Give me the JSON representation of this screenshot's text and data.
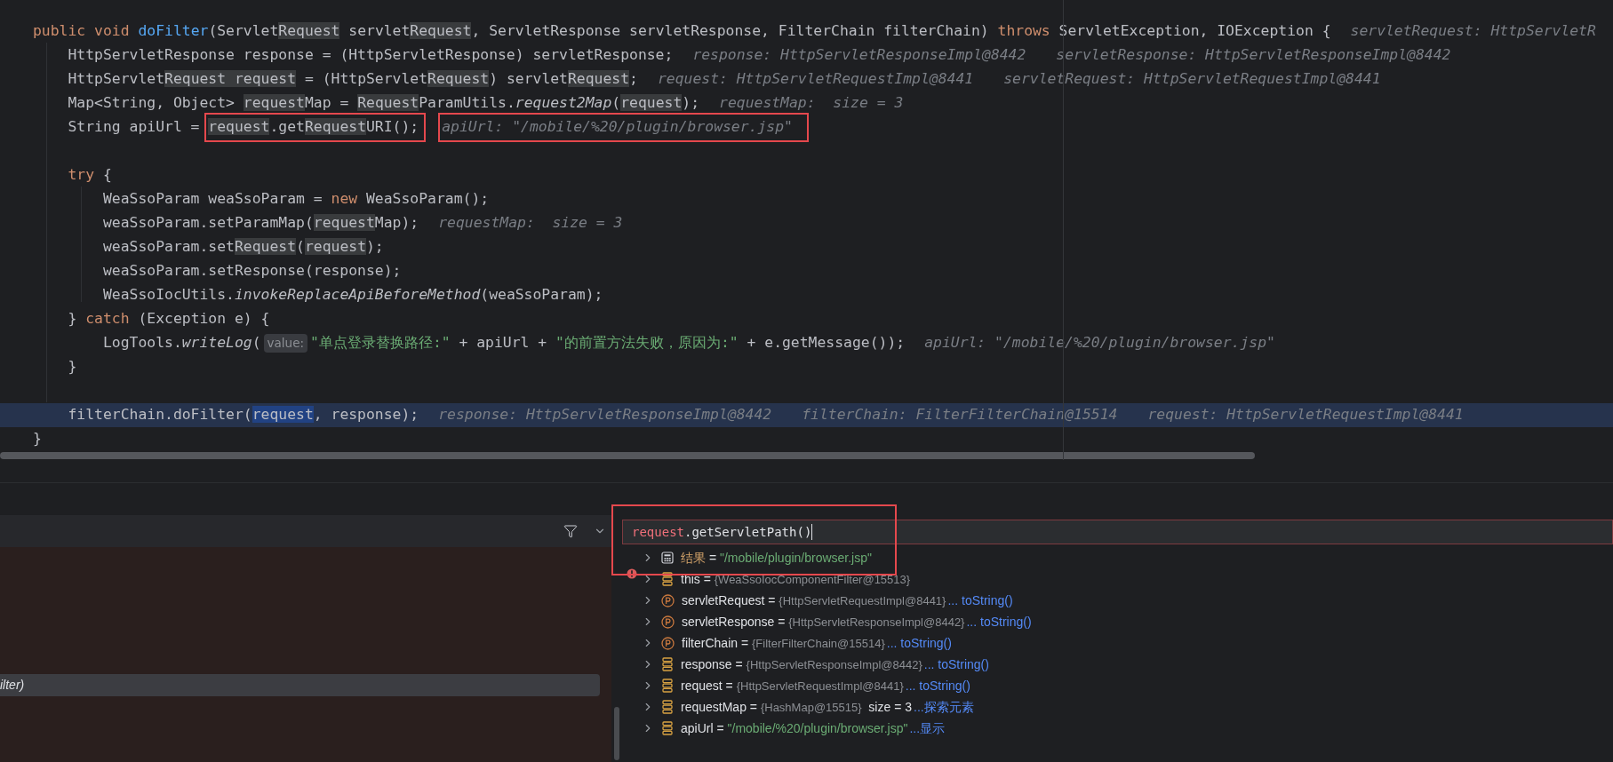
{
  "editor": {
    "lines": [
      {
        "current": false,
        "segments": [
          {
            "kind": "keyword",
            "text": "public void "
          },
          {
            "kind": "declaration",
            "text": "doFilter"
          },
          {
            "kind": "plain",
            "text": "(Servlet"
          },
          {
            "kind": "occurrence",
            "text": "Request"
          },
          {
            "kind": "plain",
            "text": " servlet"
          },
          {
            "kind": "occurrence",
            "text": "Request"
          },
          {
            "kind": "plain",
            "text": ", ServletResponse servletResponse, FilterChain filterChain) "
          },
          {
            "kind": "keyword",
            "text": "throws"
          },
          {
            "kind": "plain",
            "text": " ServletException, IOException {"
          },
          {
            "kind": "hint",
            "text": "servletRequest: HttpServletR"
          }
        ],
        "children": [
          {
            "current": false,
            "segments": [
              {
                "kind": "plain",
                "text": "HttpServletResponse response = (HttpServletResponse) servletResponse;"
              },
              {
                "kind": "hint",
                "text": "response: HttpServletResponseImpl@8442"
              },
              {
                "kind": "hint",
                "text": "servletResponse: HttpServletResponseImpl@8442"
              }
            ]
          },
          {
            "current": false,
            "segments": [
              {
                "kind": "plain",
                "text": "HttpServlet"
              },
              {
                "kind": "occurrence",
                "text": "Request request"
              },
              {
                "kind": "plain",
                "text": " = (HttpServlet"
              },
              {
                "kind": "occurrence",
                "text": "Request"
              },
              {
                "kind": "plain",
                "text": ") servlet"
              },
              {
                "kind": "occurrence",
                "text": "Request"
              },
              {
                "kind": "plain",
                "text": ";"
              },
              {
                "kind": "hint",
                "text": "request: HttpServletRequestImpl@8441"
              },
              {
                "kind": "hint",
                "text": "servletRequest: HttpServletRequestImpl@8441"
              }
            ]
          },
          {
            "current": false,
            "segments": [
              {
                "kind": "plain",
                "text": "Map<String, Object> "
              },
              {
                "kind": "occurrence",
                "text": "request"
              },
              {
                "kind": "plain",
                "text": "Map = "
              },
              {
                "kind": "occurrence",
                "text": "Request"
              },
              {
                "kind": "plain",
                "text": "ParamUtils."
              },
              {
                "kind": "static",
                "text": "request2Map"
              },
              {
                "kind": "plain",
                "text": "("
              },
              {
                "kind": "occurrence",
                "text": "request"
              },
              {
                "kind": "plain",
                "text": ");"
              },
              {
                "kind": "hint",
                "text": "requestMap:  size = 3"
              }
            ]
          },
          {
            "current": false,
            "segments": [
              {
                "kind": "plain",
                "text": "String apiUrl = "
              },
              {
                "kind": "box",
                "segments": [
                  {
                    "kind": "occurrence",
                    "text": "request"
                  },
                  {
                    "kind": "plain",
                    "text": ".get"
                  },
                  {
                    "kind": "occurrence",
                    "text": "Request"
                  },
                  {
                    "kind": "plain",
                    "text": "URI();"
                  }
                ]
              },
              {
                "kind": "box",
                "segments": [
                  {
                    "kind": "hint",
                    "text": "apiUrl: \"/mobile/%20/plugin/browser.jsp\""
                  }
                ]
              }
            ]
          },
          {
            "current": false
          },
          {
            "current": false,
            "segments": [
              {
                "kind": "keyword",
                "text": "try"
              },
              {
                "kind": "plain",
                "text": " {"
              }
            ],
            "children": [
              {
                "current": false,
                "segments": [
                  {
                    "kind": "plain",
                    "text": "WeaSsoParam weaSsoParam = "
                  },
                  {
                    "kind": "keyword",
                    "text": "new"
                  },
                  {
                    "kind": "plain",
                    "text": " WeaSsoParam();"
                  }
                ]
              },
              {
                "current": false,
                "segments": [
                  {
                    "kind": "plain",
                    "text": "weaSsoParam.setParamMap("
                  },
                  {
                    "kind": "occurrence",
                    "text": "request"
                  },
                  {
                    "kind": "plain",
                    "text": "Map);"
                  },
                  {
                    "kind": "hint",
                    "text": "requestMap:  size = 3"
                  }
                ]
              },
              {
                "current": false,
                "segments": [
                  {
                    "kind": "plain",
                    "text": "weaSsoParam.set"
                  },
                  {
                    "kind": "occurrence",
                    "text": "Request"
                  },
                  {
                    "kind": "plain",
                    "text": "("
                  },
                  {
                    "kind": "occurrence",
                    "text": "request"
                  },
                  {
                    "kind": "plain",
                    "text": ");"
                  }
                ]
              },
              {
                "current": false,
                "segments": [
                  {
                    "kind": "plain",
                    "text": "weaSsoParam.setResponse(response);"
                  }
                ]
              },
              {
                "current": false,
                "segments": [
                  {
                    "kind": "plain",
                    "text": "WeaSsoIocUtils."
                  },
                  {
                    "kind": "static",
                    "text": "invokeReplaceApiBeforeMethod"
                  },
                  {
                    "kind": "plain",
                    "text": "(weaSsoParam);"
                  }
                ]
              }
            ]
          },
          {
            "current": false,
            "segments": [
              {
                "kind": "plain",
                "text": "} "
              },
              {
                "kind": "keyword",
                "text": "catch"
              },
              {
                "kind": "plain",
                "text": " (Exception e) {"
              }
            ],
            "children": [
              {
                "current": false,
                "segments": [
                  {
                    "kind": "plain",
                    "text": "LogTools."
                  },
                  {
                    "kind": "static",
                    "text": "writeLog"
                  },
                  {
                    "kind": "plain",
                    "text": "("
                  },
                  {
                    "kind": "inlay",
                    "text": "value:"
                  },
                  {
                    "kind": "string",
                    "text": "\"单点登录替换路径:\""
                  },
                  {
                    "kind": "plain",
                    "text": " + apiUrl + "
                  },
                  {
                    "kind": "string",
                    "text": "\"的前置方法失败，原因为:\""
                  },
                  {
                    "kind": "plain",
                    "text": " + e.getMessage());"
                  },
                  {
                    "kind": "hint",
                    "text": "apiUrl: \"/mobile/%20/plugin/browser.jsp\""
                  }
                ]
              }
            ]
          },
          {
            "current": false,
            "segments": [
              {
                "kind": "plain",
                "text": "}"
              }
            ]
          },
          {
            "current": false
          },
          {
            "current": true,
            "segments": [
              {
                "kind": "plain",
                "text": "filterChain.doFilter("
              },
              {
                "kind": "selection",
                "text": "request"
              },
              {
                "kind": "plain",
                "text": ", response);"
              },
              {
                "kind": "hint",
                "text": "response: HttpServletResponseImpl@8442"
              },
              {
                "kind": "hint",
                "text": "filterChain: FilterFilterChain@15514"
              },
              {
                "kind": "hint",
                "text": "request: HttpServletRequestImpl@8441"
              }
            ]
          }
        ]
      },
      {
        "current": false,
        "segments": [
          {
            "kind": "plain",
            "text": "}"
          }
        ]
      }
    ]
  },
  "debugger": {
    "frames": [
      {
        "text": "ilter)",
        "selected": true
      }
    ],
    "expression": {
      "segments": [
        {
          "kind": "variable",
          "text": "request"
        },
        {
          "kind": "plain",
          "text": ".getServletPath()"
        }
      ]
    },
    "variables": [
      {
        "kind": "result",
        "name": "结果",
        "operator": "=",
        "value": {
          "kind": "string",
          "text": "\"/mobile/plugin/browser.jsp\""
        }
      },
      {
        "kind": "field",
        "name": "this",
        "operator": "=",
        "value": {
          "kind": "object",
          "text": "{WeaSsoIocComponentFilter@15513}"
        }
      },
      {
        "kind": "param",
        "name": "servletRequest",
        "operator": "=",
        "value": {
          "kind": "object",
          "text": "{HttpServletRequestImpl@8441}"
        },
        "link": "... toString()"
      },
      {
        "kind": "param",
        "name": "servletResponse",
        "operator": "=",
        "value": {
          "kind": "object",
          "text": "{HttpServletResponseImpl@8442}"
        },
        "link": "... toString()"
      },
      {
        "kind": "param",
        "name": "filterChain",
        "operator": "=",
        "value": {
          "kind": "object",
          "text": "{FilterFilterChain@15514}"
        },
        "link": "... toString()"
      },
      {
        "kind": "field",
        "name": "response",
        "operator": "=",
        "value": {
          "kind": "object",
          "text": "{HttpServletResponseImpl@8442}"
        },
        "link": "... toString()"
      },
      {
        "kind": "field",
        "name": "request",
        "operator": "=",
        "value": {
          "kind": "object",
          "text": "{HttpServletRequestImpl@8441}"
        },
        "link": "... toString()"
      },
      {
        "kind": "field",
        "name": "requestMap",
        "operator": "=",
        "value": {
          "kind": "object",
          "text": "{HashMap@15515}"
        },
        "detail": "size = 3",
        "link": "...探索元素"
      },
      {
        "kind": "field",
        "name": "apiUrl",
        "operator": "=",
        "value": {
          "kind": "string",
          "text": "\"/mobile/%20/plugin/browser.jsp\""
        },
        "link": "...显示"
      }
    ]
  }
}
